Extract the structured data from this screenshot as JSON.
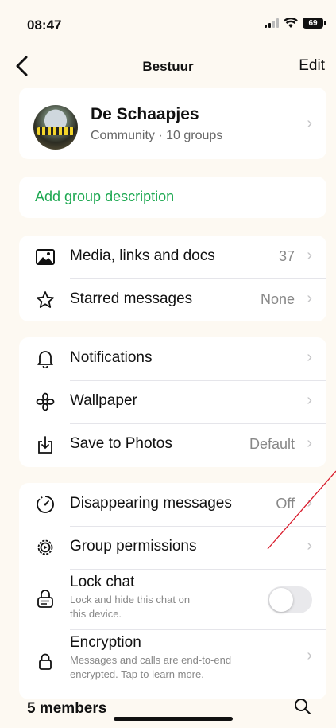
{
  "status": {
    "time": "08:47",
    "battery": "69"
  },
  "nav": {
    "title": "Bestuur",
    "edit_label": "Edit"
  },
  "header": {
    "name": "De Schaapjes",
    "subtitle": "Community · 10 groups"
  },
  "description": {
    "label": "Add group description"
  },
  "media_section": {
    "items": [
      {
        "label": "Media, links and docs",
        "value": "37",
        "icon": "image-icon"
      },
      {
        "label": "Starred messages",
        "value": "None",
        "icon": "star-icon"
      }
    ]
  },
  "settings_section": {
    "items": [
      {
        "label": "Notifications",
        "value": "",
        "icon": "bell-icon"
      },
      {
        "label": "Wallpaper",
        "value": "",
        "icon": "flower-icon"
      },
      {
        "label": "Save to Photos",
        "value": "Default",
        "icon": "download-icon"
      }
    ]
  },
  "privacy_section": {
    "disappearing": {
      "label": "Disappearing messages",
      "value": "Off",
      "icon": "timer-icon"
    },
    "permissions": {
      "label": "Group permissions",
      "icon": "gear-icon"
    },
    "lock": {
      "label": "Lock chat",
      "sub1": "Lock and hide this chat on",
      "sub2": "this device.",
      "icon": "lock-chat-icon",
      "enabled": false
    },
    "encryption": {
      "label": "Encryption",
      "sub1": "Messages and calls are end-to-end",
      "sub2": "encrypted. Tap to learn more.",
      "icon": "lock-icon"
    }
  },
  "members": {
    "label": "5 members"
  },
  "colors": {
    "accent": "#1da851",
    "background": "#fdf9f2"
  }
}
